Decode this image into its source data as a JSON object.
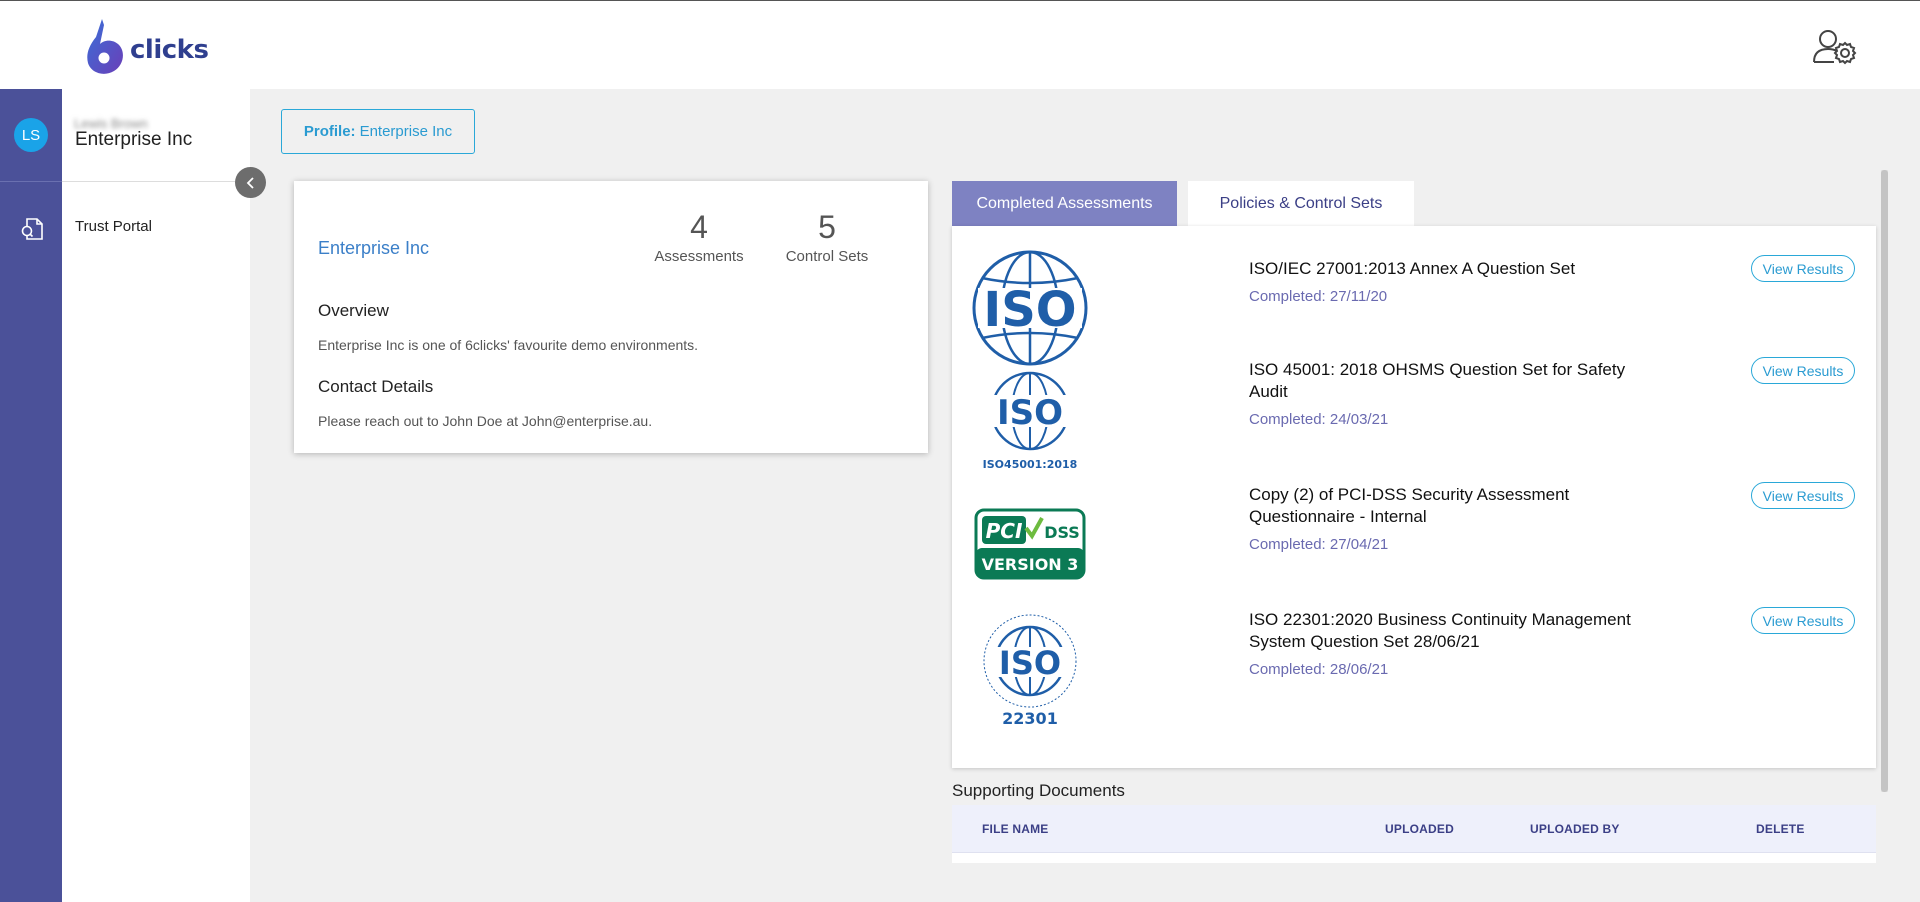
{
  "header": {
    "logo_text": "clicks",
    "logo_mark": "6"
  },
  "rail": {
    "avatar_initials": "LS"
  },
  "nav": {
    "user_name": "Lewis Brown",
    "org_name": "Enterprise Inc",
    "items": [
      {
        "label": "Trust Portal",
        "icon": "document-icon"
      }
    ]
  },
  "profile": {
    "label": "Profile:",
    "value": "Enterprise Inc"
  },
  "org_card": {
    "name": "Enterprise Inc",
    "assessments_count": "4",
    "assessments_label": "Assessments",
    "control_sets_count": "5",
    "control_sets_label": "Control Sets",
    "overview_heading": "Overview",
    "overview_text": "Enterprise Inc is one of 6clicks' favourite demo environments.",
    "contact_heading": "Contact Details",
    "contact_text": "Please reach out to John Doe at John@enterprise.au."
  },
  "tabs": [
    {
      "label": "Completed Assessments",
      "active": true
    },
    {
      "label": "Policies & Control Sets",
      "active": false
    }
  ],
  "assessments": [
    {
      "title": "ISO/IEC 27001:2013 Annex A Question Set",
      "completed": "Completed: 27/11/20",
      "button": "View Results",
      "logo": "iso-globe-logo"
    },
    {
      "title": "ISO 45001: 2018 OHSMS Question Set for Safety Audit",
      "completed": "Completed: 24/03/21",
      "button": "View Results",
      "logo": "iso-45001-logo",
      "logo_text": "ISO45001:2018"
    },
    {
      "title": "Copy (2) of PCI-DSS Security Assessment Questionnaire - Internal",
      "completed": "Completed: 27/04/21",
      "button": "View Results",
      "logo": "pci-dss-logo",
      "logo_text": "VERSION 3"
    },
    {
      "title": "ISO 22301:2020 Business Continuity Management System Question Set 28/06/21",
      "completed": "Completed: 28/06/21",
      "button": "View Results",
      "logo": "iso-22301-logo",
      "logo_text": "22301"
    }
  ],
  "supporting_docs": {
    "title": "Supporting Documents",
    "columns": [
      "FILE NAME",
      "UPLOADED",
      "UPLOADED BY",
      "DELETE"
    ]
  },
  "colors": {
    "rail": "#4b5199",
    "accent": "#2aa8d8",
    "tab_active": "#7e82c2",
    "org_name": "#3b7fc8"
  }
}
